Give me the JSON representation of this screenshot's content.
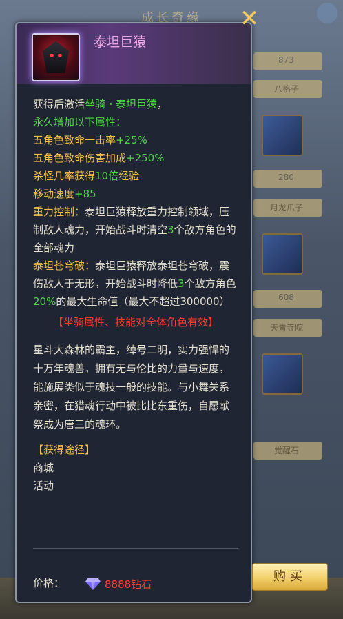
{
  "background": {
    "title": "成长奇缘",
    "side_values": [
      "873",
      "280",
      "608"
    ],
    "side_labels": [
      "八格子",
      "月龙爪子",
      "天青寺院",
      "觉醒石"
    ]
  },
  "dialog": {
    "mount_name": "泰坦巨猿",
    "intro_prefix": "获得后激活",
    "intro_mount": "坐骑・泰坦巨猿",
    "intro_suffix": "，",
    "perm_line": "永久增加以下属性：",
    "attrs": [
      {
        "label": "五角色致命一击率",
        "value": "+25%"
      },
      {
        "label": "五角色致命伤害加成",
        "value": "+250%"
      },
      {
        "label": "杀怪几率获得",
        "value": "10倍",
        "suffix": "经验"
      },
      {
        "label": "移动速度",
        "value": "+85"
      }
    ],
    "skill1_name": "重力控制：",
    "skill1_text_a": "泰坦巨猿释放重力控制领域，压制敌人魂力，开始战斗时清空",
    "skill1_num": "3",
    "skill1_text_b": "个敌方角色的全部魂力",
    "skill2_name": "泰坦苍穹破：",
    "skill2_text_a": "泰坦巨猿释放泰坦苍穹破，震伤敌人于无形，开始战斗时降低",
    "skill2_num": "3",
    "skill2_text_b": "个敌方角色",
    "skill2_pct": "20%",
    "skill2_text_c": "的最大生命值（最大不超过300000）",
    "notice": "【坐骑属性、技能对全体角色有效】",
    "lore": "星斗大森林的霸主，绰号二明，实力强悍的十万年魂兽，拥有无与伦比的力量与速度，能施展类似于魂技一般的技能。与小舞关系亲密，在猎魂行动中被比比东重伤，自愿献祭成为唐三的魂环。",
    "source_title": "【获得途径】",
    "sources": [
      "商城",
      "活动"
    ],
    "price_label": "价格：",
    "price_value": "8888钻石",
    "buy_label": "购买",
    "close_icon": "close-icon"
  },
  "colors": {
    "green": "#53d24b",
    "gold": "#f0c04a",
    "red": "#ff3b30",
    "name": "#f0a7e6"
  }
}
